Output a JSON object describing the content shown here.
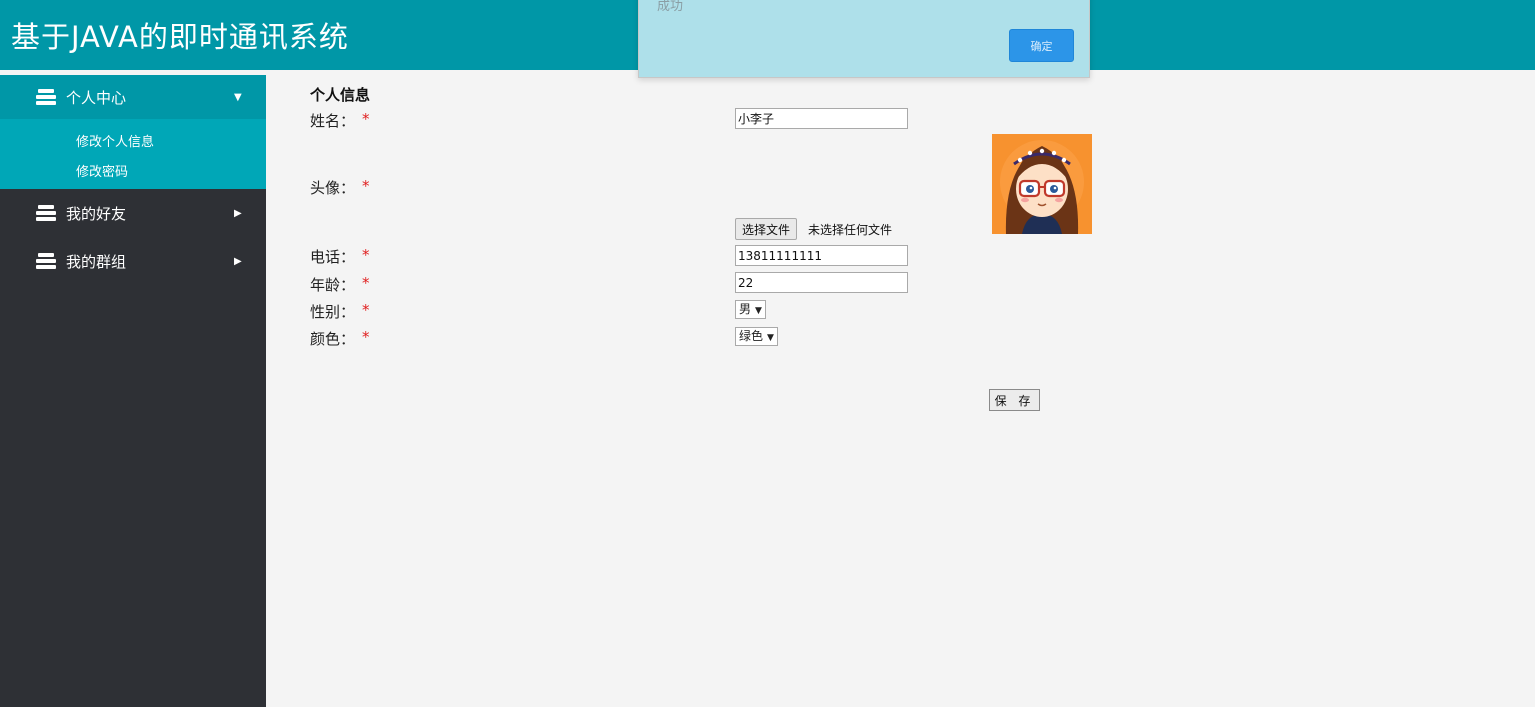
{
  "header": {
    "title": "基于JAVA的即时通讯系统"
  },
  "sidebar": {
    "items": [
      {
        "label": "个人中心",
        "icon": "stack-icon",
        "expanded": true,
        "submenu": [
          {
            "label": "修改个人信息"
          },
          {
            "label": "修改密码"
          }
        ]
      },
      {
        "label": "我的好友",
        "icon": "stack-icon",
        "expanded": false
      },
      {
        "label": "我的群组",
        "icon": "stack-icon",
        "expanded": false
      }
    ]
  },
  "form": {
    "title": "个人信息",
    "required_mark": "*",
    "name": {
      "label": "姓名：",
      "value": "小李子"
    },
    "avatar": {
      "label": "头像：",
      "file_button": "选择文件",
      "file_status": "未选择任何文件"
    },
    "phone": {
      "label": "电话：",
      "value": "13811111111"
    },
    "age": {
      "label": "年龄：",
      "value": "22"
    },
    "gender": {
      "label": "性别：",
      "selected": "男"
    },
    "color": {
      "label": "颜色：",
      "selected": "绿色"
    },
    "save_button": "保 存"
  },
  "dialog": {
    "message": "成功",
    "ok_button": "确定"
  },
  "colors": {
    "header_bg": "#0097a7",
    "sidebar_bg": "#2e3035",
    "submenu_bg": "#00a7b7",
    "required": "#e02020",
    "dialog_bg": "#aee0ea",
    "dialog_button": "#2c95e8"
  }
}
